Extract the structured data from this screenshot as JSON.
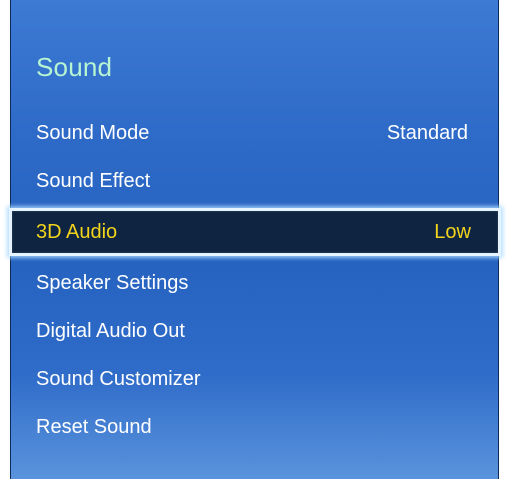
{
  "menu": {
    "title": "Sound",
    "items": [
      {
        "label": "Sound Mode",
        "value": "Standard"
      },
      {
        "label": "Sound Effect",
        "value": ""
      },
      {
        "label": "3D Audio",
        "value": "Low",
        "selected": true
      },
      {
        "label": "Speaker Settings",
        "value": ""
      },
      {
        "label": "Digital Audio Out",
        "value": ""
      },
      {
        "label": "Sound Customizer",
        "value": ""
      },
      {
        "label": "Reset Sound",
        "value": ""
      }
    ]
  },
  "colors": {
    "panel_background": "#2d69c6",
    "title_text": "#b6f4d2",
    "item_text": "#ffffff",
    "selected_text": "#f3d41b",
    "selected_background": "#0e2440",
    "selected_border": "#e6f4ff"
  }
}
